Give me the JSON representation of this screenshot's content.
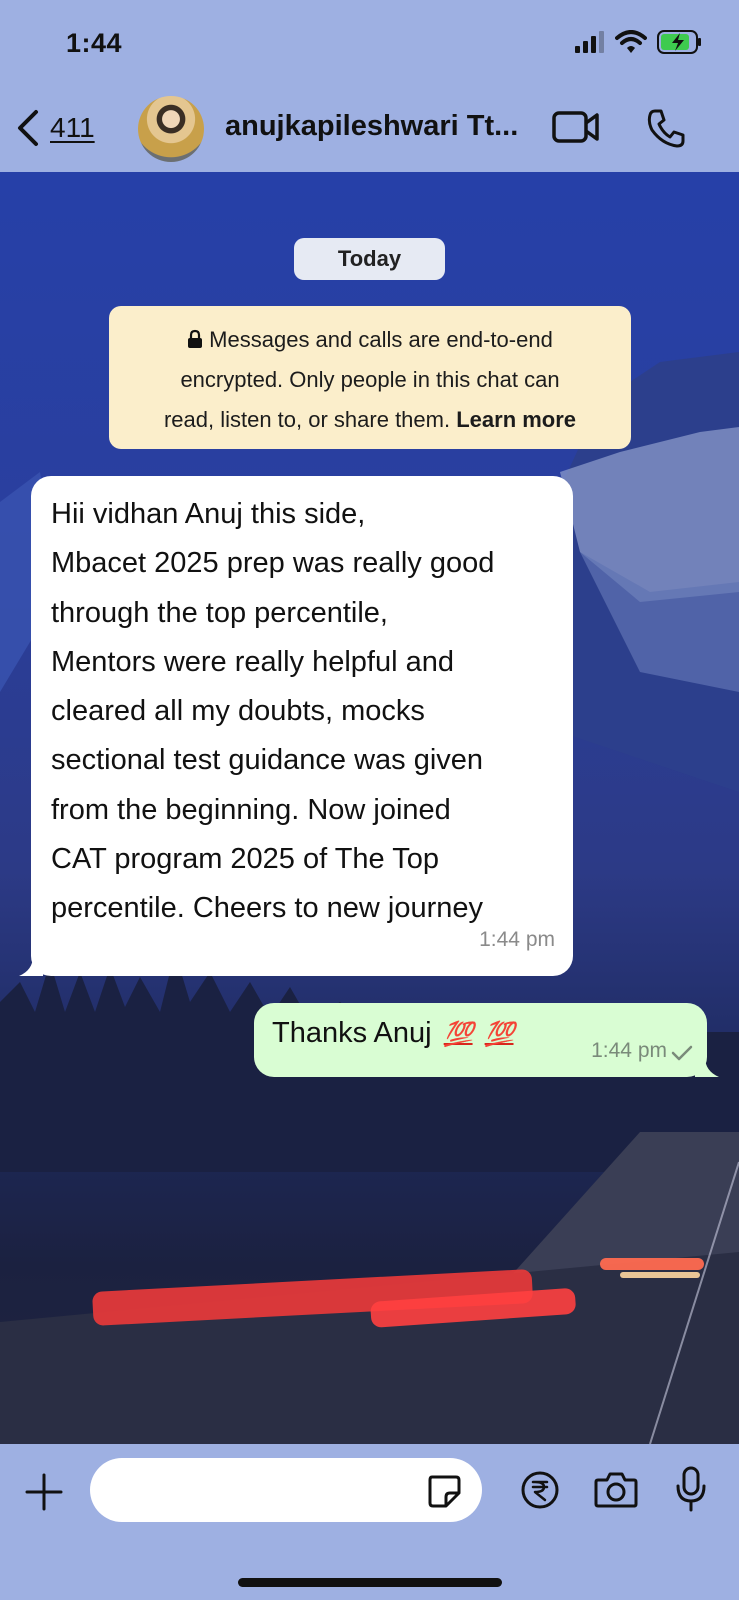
{
  "status_bar": {
    "time": "1:44"
  },
  "header": {
    "back_count": "411",
    "contact_name": "anujkapileshwari Tt...",
    "video_icon": "video-camera-icon",
    "call_icon": "phone-icon"
  },
  "chat": {
    "date_chip": "Today",
    "encryption_notice": {
      "lines": [
        "Messages and calls are end-to-end",
        "encrypted. Only people in this chat can",
        "read, listen to, or share them."
      ],
      "link": "Learn more"
    },
    "messages": [
      {
        "direction": "incoming",
        "lines": [
          "Hii vidhan Anuj this side,",
          "Mbacet 2025 prep was really good",
          "through the top percentile,",
          "Mentors were really helpful and",
          "cleared all my doubts, mocks",
          "sectional test guidance was given",
          "from the beginning. Now joined",
          "CAT program 2025 of The Top",
          "percentile. Cheers to new journey"
        ],
        "time": "1:44 pm"
      },
      {
        "direction": "outgoing",
        "text": "Thanks Anuj",
        "emoji": [
          "💯",
          "💯"
        ],
        "time": "1:44 pm",
        "status": "sent"
      }
    ]
  },
  "input_bar": {
    "placeholder": "",
    "icons": [
      "plus-icon",
      "sticker-icon",
      "rupee-icon",
      "camera-icon",
      "microphone-icon"
    ]
  },
  "colors": {
    "bar_background": "#9eb0e2",
    "incoming_bubble": "#ffffff",
    "outgoing_bubble": "#d9fdd3",
    "notice_background": "#fbeecb",
    "hundred_emoji": "#d8261d"
  }
}
